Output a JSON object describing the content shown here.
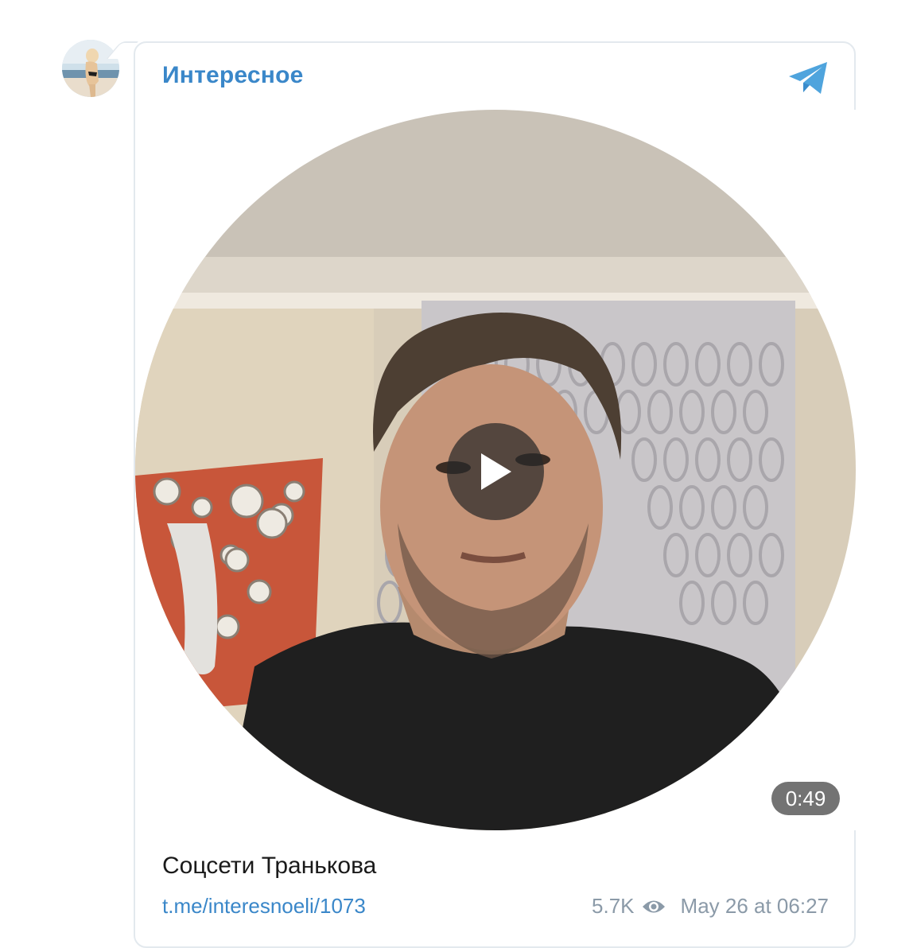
{
  "channel": {
    "name": "Интересное"
  },
  "post": {
    "caption": "Соцсети Транькова",
    "link": "t.me/interesnoeli/1073",
    "views": "5.7K",
    "date": "May 26 at 06:27",
    "video_duration": "0:49"
  },
  "icons": {
    "telegram": "telegram-icon",
    "play": "play-icon",
    "views": "eye-icon"
  },
  "colors": {
    "accent": "#3a87c9",
    "meta": "#8b9aa8",
    "caption": "#1a1a1a"
  }
}
